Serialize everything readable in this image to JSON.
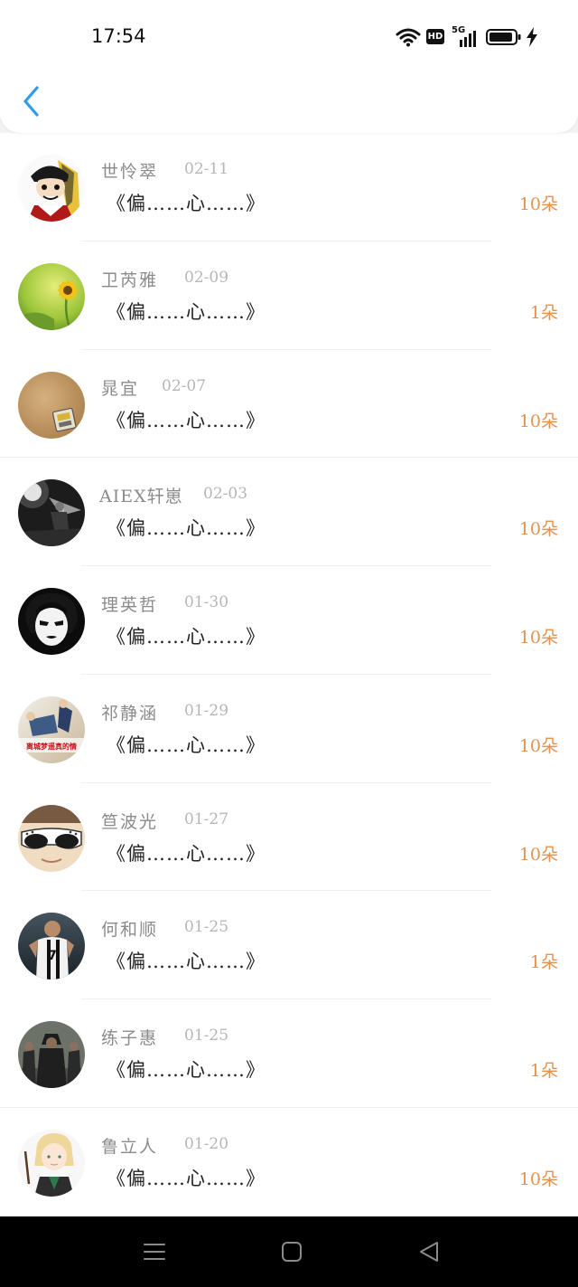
{
  "status_bar": {
    "time": "17:54",
    "hd": "HD",
    "network": "5G"
  },
  "header": {
    "back_icon": "chevron-left-icon",
    "accent": "#2e9bf0"
  },
  "list": {
    "message": "《偏……心……》",
    "count_color": "#e39250",
    "items": [
      {
        "name": "世怜翠",
        "date": "02-11",
        "count": "10朵"
      },
      {
        "name": "卫芮雅",
        "date": "02-09",
        "count": "1朵"
      },
      {
        "name": "晁宜",
        "date": "02-07",
        "count": "10朵"
      },
      {
        "name": "AIEX轩崽",
        "date": "02-03",
        "count": "10朵"
      },
      {
        "name": "理英哲",
        "date": "01-30",
        "count": "10朵"
      },
      {
        "name": "祁静涵",
        "date": "01-29",
        "count": "10朵"
      },
      {
        "name": "笪波光",
        "date": "01-27",
        "count": "10朵"
      },
      {
        "name": "何和顺",
        "date": "01-25",
        "count": "1朵"
      },
      {
        "name": "练子惠",
        "date": "01-25",
        "count": "1朵"
      },
      {
        "name": "鲁立人",
        "date": "01-20",
        "count": "10朵"
      }
    ]
  },
  "avatar_texts": {
    "a6": "离城梦遥真的情"
  },
  "nav_bar": {
    "menu_icon": "menu-icon",
    "home_icon": "home-square-icon",
    "back_icon": "back-triangle-icon"
  }
}
